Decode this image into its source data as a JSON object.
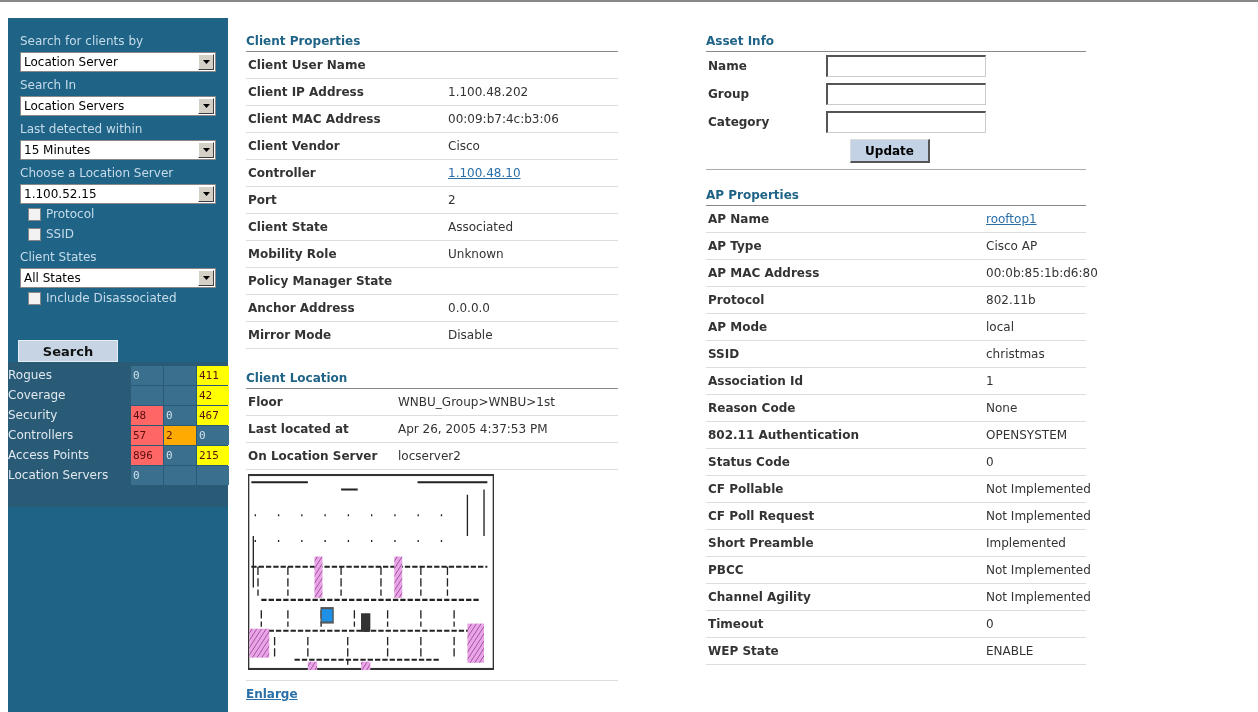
{
  "sidebar": {
    "fields": [
      {
        "kind": "select",
        "label": "Search for clients by",
        "value": "Location Server"
      },
      {
        "kind": "select",
        "label": "Search In",
        "value": "Location Servers"
      },
      {
        "kind": "select",
        "label": "Last detected within",
        "value": "15 Minutes"
      },
      {
        "kind": "select",
        "label": "Choose a Location Server",
        "value": "1.100.52.15"
      },
      {
        "kind": "checkbox",
        "label": "Protocol",
        "checked": false
      },
      {
        "kind": "checkbox",
        "label": "SSID",
        "checked": false
      },
      {
        "kind": "select",
        "label": "Client States",
        "value": "All States"
      },
      {
        "kind": "checkbox",
        "label": "Include Disassociated",
        "checked": false
      }
    ],
    "search_button": "Search",
    "alarm_summary": [
      {
        "label": "Rogues",
        "cells": [
          {
            "kind": "count",
            "value": "0"
          },
          {
            "kind": "empty"
          },
          {
            "kind": "count",
            "value": "411",
            "color": "#ffff00"
          }
        ]
      },
      {
        "label": "Coverage",
        "cells": [
          {
            "kind": "empty"
          },
          {
            "kind": "empty"
          },
          {
            "kind": "count",
            "value": "42",
            "color": "#ffff00"
          }
        ]
      },
      {
        "label": "Security",
        "cells": [
          {
            "kind": "count",
            "value": "48",
            "color": "#ff6666"
          },
          {
            "kind": "count",
            "value": "0"
          },
          {
            "kind": "count",
            "value": "467",
            "color": "#ffff00"
          }
        ]
      },
      {
        "label": "Controllers",
        "cells": [
          {
            "kind": "count",
            "value": "57",
            "color": "#ff6666"
          },
          {
            "kind": "count",
            "value": "2",
            "color": "#ffaa00"
          },
          {
            "kind": "count",
            "value": "0"
          }
        ]
      },
      {
        "label": "Access Points",
        "cells": [
          {
            "kind": "count",
            "value": "896",
            "color": "#ff6666"
          },
          {
            "kind": "count",
            "value": "0"
          },
          {
            "kind": "count",
            "value": "215",
            "color": "#ffff00"
          }
        ]
      },
      {
        "label": "Location Servers",
        "cells": [
          {
            "kind": "count",
            "value": "0"
          },
          {
            "kind": "empty"
          },
          {
            "kind": "empty"
          }
        ]
      }
    ]
  },
  "client_properties": {
    "title": "Client Properties",
    "rows": [
      {
        "label": "Client User Name"
      },
      {
        "label": "Client IP Address",
        "value": "1.100.48.202"
      },
      {
        "label": "Client MAC Address",
        "value": "00:09:b7:4c:b3:06"
      },
      {
        "label": "Client Vendor",
        "value": "Cisco"
      },
      {
        "label": "Controller",
        "value": "1.100.48.10",
        "kind": "link"
      },
      {
        "label": "Port",
        "value": "2"
      },
      {
        "label": "Client State",
        "value": "Associated"
      },
      {
        "label": "Mobility Role",
        "value": "Unknown"
      },
      {
        "label": "Policy Manager State"
      },
      {
        "label": "Anchor Address",
        "value": "0.0.0.0"
      },
      {
        "label": "Mirror Mode",
        "value": "Disable"
      }
    ]
  },
  "client_location": {
    "title": "Client Location",
    "rows": [
      {
        "label": "Floor",
        "value": "WNBU_Group>WNBU>1st"
      },
      {
        "label": "Last located at",
        "value": "Apr 26, 2005 4:37:53 PM"
      },
      {
        "label": "On Location Server",
        "value": "locserver2"
      }
    ],
    "enlarge_link": "Enlarge"
  },
  "asset_info": {
    "title": "Asset Info",
    "fields": [
      {
        "label": "Name"
      },
      {
        "label": "Group"
      },
      {
        "label": "Category"
      }
    ],
    "update_button": "Update"
  },
  "ap_properties": {
    "title": "AP Properties",
    "rows": [
      {
        "label": "AP Name",
        "value": "rooftop1",
        "kind": "link"
      },
      {
        "label": "AP Type",
        "value": "Cisco AP"
      },
      {
        "label": "AP MAC Address",
        "value": "00:0b:85:1b:d6:80"
      },
      {
        "label": "Protocol",
        "value": "802.11b"
      },
      {
        "label": "AP Mode",
        "value": "local"
      },
      {
        "label": "SSID",
        "value": "christmas"
      },
      {
        "label": "Association Id",
        "value": "1"
      },
      {
        "label": "Reason Code",
        "value": "None"
      },
      {
        "label": "802.11 Authentication",
        "value": "OPENSYSTEM"
      },
      {
        "label": "Status Code",
        "value": "0"
      },
      {
        "label": "CF Pollable",
        "value": "Not Implemented"
      },
      {
        "label": "CF Poll Request",
        "value": "Not Implemented"
      },
      {
        "label": "Short Preamble",
        "value": "Implemented"
      },
      {
        "label": "PBCC",
        "value": "Not Implemented"
      },
      {
        "label": "Channel Agility",
        "value": "Not Implemented"
      },
      {
        "label": "Timeout",
        "value": "0"
      },
      {
        "label": "WEP State",
        "value": "ENABLE"
      }
    ]
  }
}
